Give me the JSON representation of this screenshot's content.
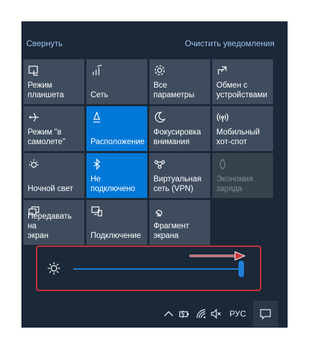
{
  "header": {
    "collapse_label": "Свернуть",
    "clear_label": "Очистить уведомления"
  },
  "tiles": [
    {
      "label": "Режим\nпланшета",
      "icon": "tablet-mode-icon",
      "state": "off"
    },
    {
      "label": "Сеть",
      "icon": "network-icon",
      "state": "off"
    },
    {
      "label": "Все\nпараметры",
      "icon": "gear-icon",
      "state": "off"
    },
    {
      "label": "Обмен с\nустройствами",
      "icon": "share-icon",
      "state": "off"
    },
    {
      "label": "Режим \"в\nсамолете\"",
      "icon": "airplane-icon",
      "state": "off"
    },
    {
      "label": "Расположение",
      "icon": "location-icon",
      "state": "on"
    },
    {
      "label": "Фокусировка\nвнимания",
      "icon": "moon-icon",
      "state": "off"
    },
    {
      "label": "Мобильный\nхот-спот",
      "icon": "hotspot-icon",
      "state": "off"
    },
    {
      "label": "Ночной свет",
      "icon": "night-light-icon",
      "state": "off"
    },
    {
      "label": "Не\nподключено",
      "icon": "bluetooth-icon",
      "state": "on"
    },
    {
      "label": "Виртуальная\nсеть (VPN)",
      "icon": "vpn-icon",
      "state": "off"
    },
    {
      "label": "Экономия\nзаряда",
      "icon": "battery-saver-icon",
      "state": "disabled"
    },
    {
      "label": "Передавать на\nэкран",
      "icon": "project-icon",
      "state": "off"
    },
    {
      "label": "Подключение",
      "icon": "connect-icon",
      "state": "off"
    },
    {
      "label": "Фрагмент\nэкрана",
      "icon": "snip-icon",
      "state": "off"
    }
  ],
  "brightness": {
    "level": 1.0,
    "icon": "brightness-icon"
  },
  "taskbar": {
    "language": "РУС",
    "icons": [
      "chevron-up-icon",
      "battery-icon",
      "wifi-icon",
      "volume-muted-icon",
      "notification-icon"
    ]
  },
  "colors": {
    "panel_bg": "#1b2838",
    "tile_bg": "#3f4c5e",
    "tile_active": "#0078d7",
    "link": "#9fc4ee",
    "highlight": "#c8323a"
  }
}
